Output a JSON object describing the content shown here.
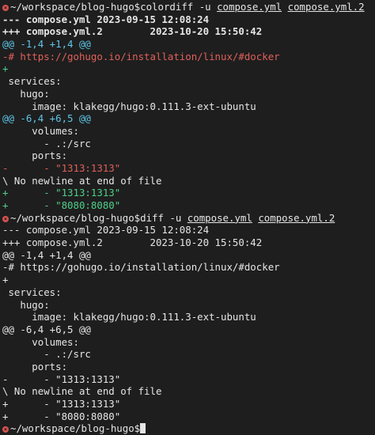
{
  "lines": [
    {
      "class": "",
      "parts": [
        {
          "t": "~/workspace/blog-hugo$colordiff -u ",
          "c": ""
        },
        {
          "t": "compose.yml",
          "c": "u"
        },
        {
          "t": " ",
          "c": ""
        },
        {
          "t": "compose.yml.2",
          "c": "u"
        }
      ],
      "marker": true
    },
    {
      "class": "bold",
      "parts": [
        {
          "t": "--- compose.yml 2023-09-15 12:08:24",
          "c": ""
        }
      ]
    },
    {
      "class": "bold",
      "parts": [
        {
          "t": "+++ compose.yml.2        2023-10-20 15:50:42",
          "c": ""
        }
      ]
    },
    {
      "class": "cyan",
      "parts": [
        {
          "t": "@@ -1,4 +1,4 @@",
          "c": ""
        }
      ]
    },
    {
      "class": "red",
      "parts": [
        {
          "t": "-# https://gohugo.io/installation/linux/#docker",
          "c": ""
        }
      ]
    },
    {
      "class": "green",
      "parts": [
        {
          "t": "+",
          "c": ""
        }
      ]
    },
    {
      "class": "",
      "parts": [
        {
          "t": " services:",
          "c": ""
        }
      ]
    },
    {
      "class": "",
      "parts": [
        {
          "t": "   hugo:",
          "c": ""
        }
      ]
    },
    {
      "class": "",
      "parts": [
        {
          "t": "     image: klakegg/hugo:0.111.3-ext-ubuntu",
          "c": ""
        }
      ]
    },
    {
      "class": "cyan",
      "parts": [
        {
          "t": "@@ -6,4 +6,5 @@",
          "c": ""
        }
      ]
    },
    {
      "class": "",
      "parts": [
        {
          "t": "     volumes:",
          "c": ""
        }
      ]
    },
    {
      "class": "",
      "parts": [
        {
          "t": "       - .:/src",
          "c": ""
        }
      ]
    },
    {
      "class": "",
      "parts": [
        {
          "t": "     ports:",
          "c": ""
        }
      ]
    },
    {
      "class": "red",
      "parts": [
        {
          "t": "-      - \"1313:1313\"",
          "c": ""
        }
      ]
    },
    {
      "class": "",
      "parts": [
        {
          "t": "\\ No newline at end of file",
          "c": ""
        }
      ]
    },
    {
      "class": "green",
      "parts": [
        {
          "t": "+      - \"1313:1313\"",
          "c": ""
        }
      ]
    },
    {
      "class": "green",
      "parts": [
        {
          "t": "+      - \"8080:8080\"",
          "c": ""
        }
      ]
    },
    {
      "class": "",
      "parts": [
        {
          "t": "~/workspace/blog-hugo$diff -u ",
          "c": ""
        },
        {
          "t": "compose.yml",
          "c": "u"
        },
        {
          "t": " ",
          "c": ""
        },
        {
          "t": "compose.yml.2",
          "c": "u"
        }
      ],
      "marker": true
    },
    {
      "class": "",
      "parts": [
        {
          "t": "--- compose.yml 2023-09-15 12:08:24",
          "c": ""
        }
      ]
    },
    {
      "class": "",
      "parts": [
        {
          "t": "+++ compose.yml.2        2023-10-20 15:50:42",
          "c": ""
        }
      ]
    },
    {
      "class": "",
      "parts": [
        {
          "t": "@@ -1,4 +1,4 @@",
          "c": ""
        }
      ]
    },
    {
      "class": "",
      "parts": [
        {
          "t": "-# https://gohugo.io/installation/linux/#docker",
          "c": ""
        }
      ]
    },
    {
      "class": "",
      "parts": [
        {
          "t": "+",
          "c": ""
        }
      ]
    },
    {
      "class": "",
      "parts": [
        {
          "t": " services:",
          "c": ""
        }
      ]
    },
    {
      "class": "",
      "parts": [
        {
          "t": "   hugo:",
          "c": ""
        }
      ]
    },
    {
      "class": "",
      "parts": [
        {
          "t": "     image: klakegg/hugo:0.111.3-ext-ubuntu",
          "c": ""
        }
      ]
    },
    {
      "class": "",
      "parts": [
        {
          "t": "@@ -6,4 +6,5 @@",
          "c": ""
        }
      ]
    },
    {
      "class": "",
      "parts": [
        {
          "t": "     volumes:",
          "c": ""
        }
      ]
    },
    {
      "class": "",
      "parts": [
        {
          "t": "       - .:/src",
          "c": ""
        }
      ]
    },
    {
      "class": "",
      "parts": [
        {
          "t": "     ports:",
          "c": ""
        }
      ]
    },
    {
      "class": "",
      "parts": [
        {
          "t": "-      - \"1313:1313\"",
          "c": ""
        }
      ]
    },
    {
      "class": "",
      "parts": [
        {
          "t": "\\ No newline at end of file",
          "c": ""
        }
      ]
    },
    {
      "class": "",
      "parts": [
        {
          "t": "+      - \"1313:1313\"",
          "c": ""
        }
      ]
    },
    {
      "class": "",
      "parts": [
        {
          "t": "+      - \"8080:8080\"",
          "c": ""
        }
      ]
    },
    {
      "class": "",
      "parts": [
        {
          "t": "~/workspace/blog-hugo$",
          "c": ""
        }
      ],
      "marker": true,
      "cursor": true
    }
  ],
  "colors": {
    "background": "#1e1e1e",
    "foreground": "#e6e6e6",
    "hunk": "#5ec6e8",
    "removed": "#e0605a",
    "added": "#4fd08a",
    "marker": "#d9534f"
  },
  "icons": {
    "prompt_marker": "x-circle-icon",
    "cursor": "block-cursor"
  }
}
